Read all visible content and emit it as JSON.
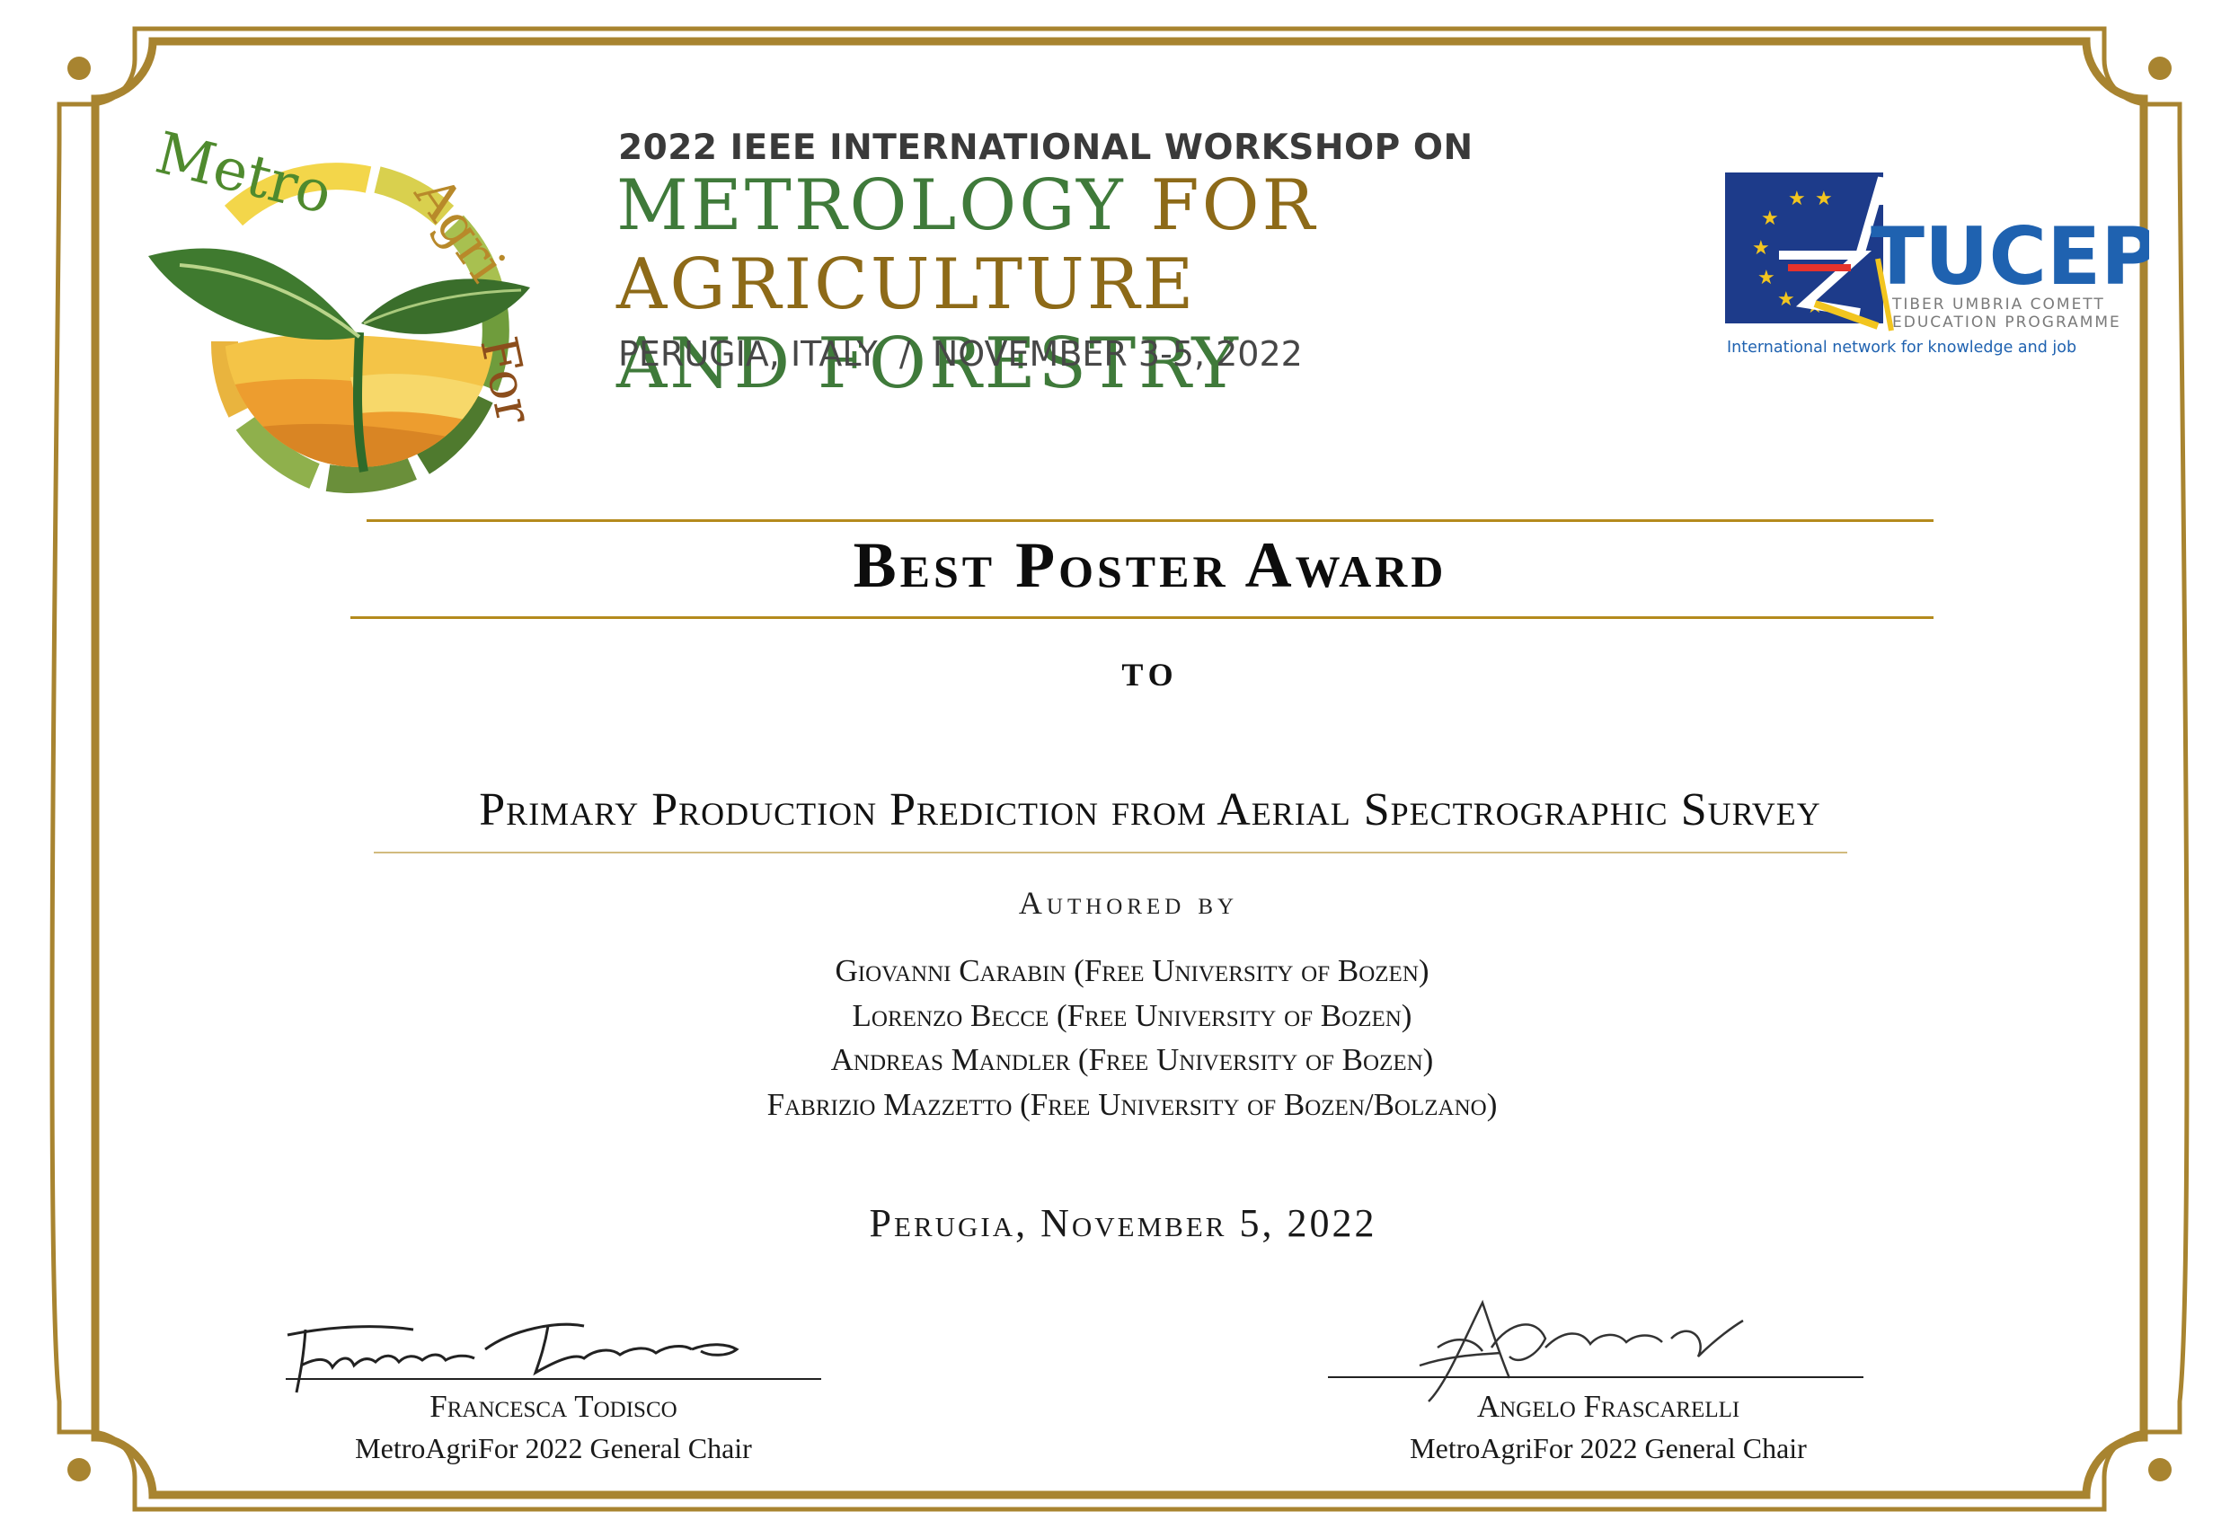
{
  "header": {
    "workshop_line": "2022 IEEE INTERNATIONAL WORKSHOP ON",
    "title_part1": "METROLOGY ",
    "title_part2": "FOR AGRICULTURE",
    "title_part3": "AND FORESTRY",
    "location_date": "PERUGIA, ITALY  /  NOVEMBER 3-5, 2022"
  },
  "logo_left": {
    "icon": "metroagrifor-logo",
    "text_metro": "Metro",
    "text_agri": "Agri",
    "text_for": "For"
  },
  "logo_right": {
    "icon": "tucep-logo",
    "name": "TUCEP",
    "line1": "TIBER UMBRIA COMETT",
    "line2": "EDUCATION PROGRAMME",
    "tagline": "International network for knowledge and job"
  },
  "award": {
    "title": "Best Poster Award",
    "to_label": "TO",
    "paper_title": "Primary Production Prediction from Aerial Spectrographic Survey",
    "authored_label": "Authored by",
    "authors": [
      "Giovanni Carabin (Free University of Bozen)",
      "Lorenzo Becce (Free University of Bozen)",
      "Andreas Mandler (Free University of Bozen)",
      "Fabrizio Mazzetto (Free University of Bozen/Bolzano)"
    ],
    "date": "Perugia, November 5, 2022"
  },
  "signatories": [
    {
      "name": "Francesca Todisco",
      "role": "MetroAgriFor 2022 General Chair"
    },
    {
      "name": "Angelo Frascarelli",
      "role": "MetroAgriFor 2022 General Chair"
    }
  ],
  "colors": {
    "frame_gold": "#a88430",
    "green": "#3f7a3a",
    "gold_text": "#8d6a18",
    "eu_blue": "#1d3b8a",
    "tucep_blue": "#1f62b0"
  }
}
